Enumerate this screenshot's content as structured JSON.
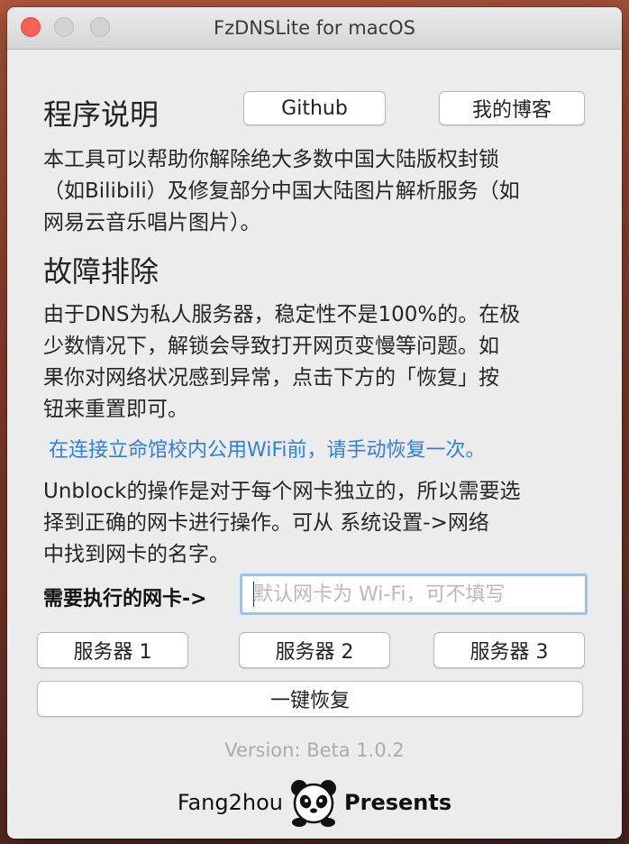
{
  "window": {
    "title": "FzDNSLite for macOS"
  },
  "intro": {
    "heading": "程序说明",
    "github_label": "Github",
    "blog_label": "我的博客",
    "lines": [
      "本工具可以帮助你解除绝大多数中国大陆版权封锁",
      "（如Bilibili）及修复部分中国大陆图片解析服务（如",
      "网易云音乐唱片图片）。"
    ]
  },
  "troubleshoot": {
    "heading": "故障排除",
    "lines": [
      "由于DNS为私人服务器，稳定性不是100%的。在极",
      "少数情况下，解锁会导致打开网页变慢等问题。如",
      "果你对网络状况感到异常，点击下方的「恢复」按",
      "钮来重置即可。"
    ],
    "warning": "在连接立命馆校内公用WiFi前，请手动恢复一次。",
    "unblock_lines": [
      "Unblock的操作是对于每个网卡独立的，所以需要选",
      "择到正确的网卡进行操作。可从 系统设置->网络",
      "中找到网卡的名字。"
    ]
  },
  "nic": {
    "label": "需要执行的网卡->",
    "value": "",
    "placeholder": "默认网卡为 Wi-Fi，可不填写"
  },
  "servers": {
    "server1": "服务器 1",
    "server2": "服务器 2",
    "server3": "服务器 3",
    "restore": "一键恢复"
  },
  "version": "Version: Beta 1.0.2",
  "footer": {
    "left": "Fang2hou",
    "right": "Presents",
    "logo_icon": "panda-icon"
  }
}
